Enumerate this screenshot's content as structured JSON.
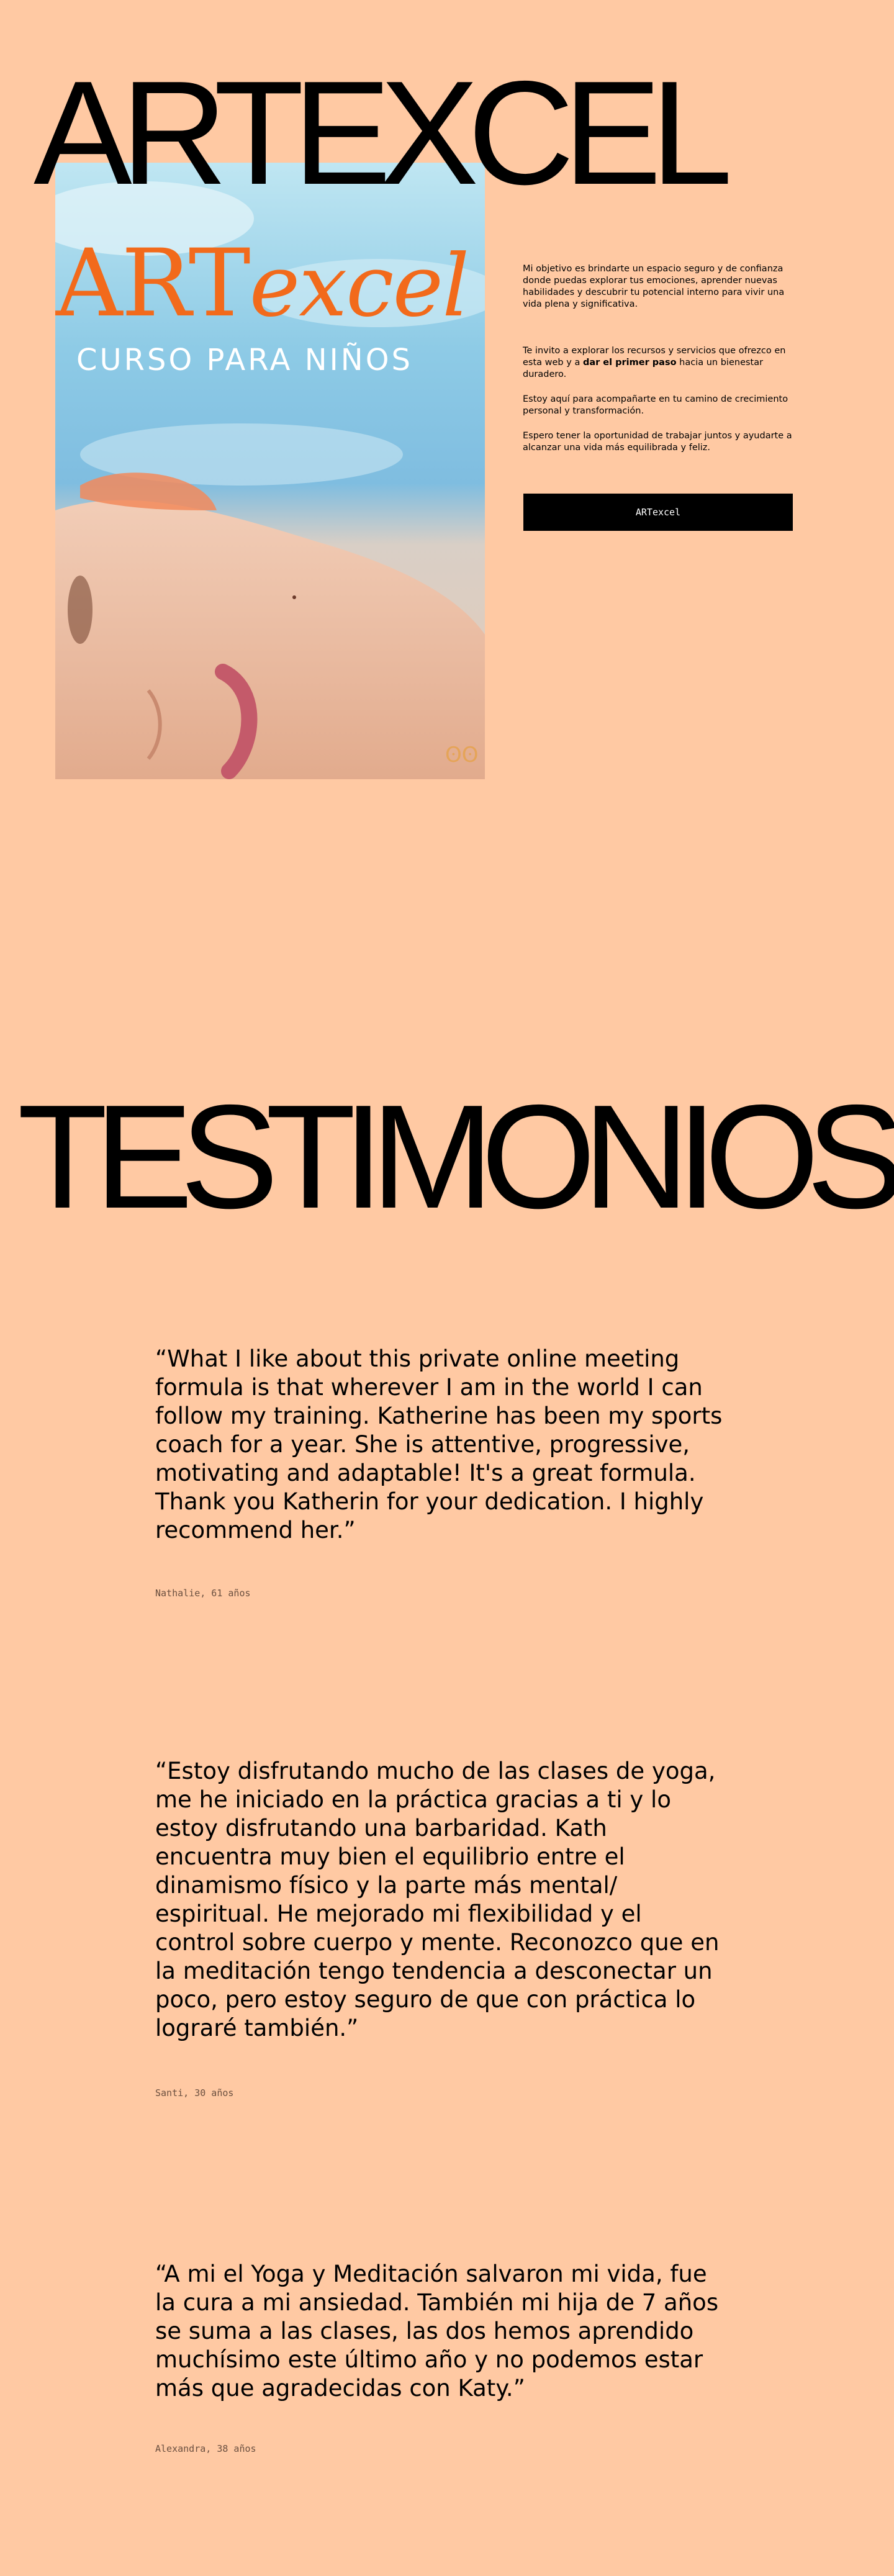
{
  "header": {
    "title": "ARTEXCEL"
  },
  "hero": {
    "brand_part1": "ART",
    "brand_part2": "excel",
    "subtitle": "CURSO PARA NIÑOS",
    "colors": {
      "brand_orange": "#f26a1b",
      "sky": "#8ecbe6"
    }
  },
  "intro": {
    "p1": "Mi objetivo es brindarte un espacio seguro y de confianza donde puedas explorar tus emociones, aprender nuevas habilidades y descubrir tu potencial interno para vivir una vida plena y significativa.",
    "p2_before": "Te invito a explorar los recursos y servicios que ofrezco en esta web y a ",
    "p2_strong": "dar el primer paso",
    "p2_after": " hacia un bienestar duradero.",
    "p3": "Estoy aquí para acompañarte en tu camino de crecimiento personal y transformación.",
    "p4": "Espero tener la oportunidad de trabajar juntos y ayudarte a alcanzar una vida más equilibrada y feliz.",
    "button_label": "ARTexcel"
  },
  "testimonials": {
    "heading": "TESTIMONIOS",
    "items": [
      {
        "quote": "“What I like about this private online meeting formula is that wherever I am in the world I can follow my training. Katherine has been my sports coach for a year. She is attentive, progressive, motivating and adaptable! It's a great formula. Thank you Katherin for your dedication. I highly recommend her.”",
        "author": "Nathalie, 61 años"
      },
      {
        "quote": "“Estoy disfrutando mucho de las clases de yoga, me he iniciado en la práctica gracias a ti y lo estoy disfrutando una barbaridad. Kath encuentra muy bien el equilibrio entre el dinamismo físico y la parte más mental/ espiritual. He mejorado mi flexibilidad y el control sobre cuerpo y mente. Reconozco que en la meditación tengo tendencia a desconectar un poco, pero estoy seguro de que con práctica lo lograré también.”",
        "author": "Santi, 30 años"
      },
      {
        "quote": "“A mi el Yoga y Meditación salvaron mi vida, fue la cura a mi ansiedad. También mi hija de 7 años se suma a las clases, las dos hemos aprendido muchísimo este último año y no podemos estar más que agradecidas con Katy.”",
        "author": "Alexandra, 38 años"
      }
    ]
  },
  "colors": {
    "page_background": "#ffc9a3",
    "text": "#000000",
    "button_background": "#000000",
    "button_text": "#ffffff",
    "author_text": "#6b5040"
  }
}
